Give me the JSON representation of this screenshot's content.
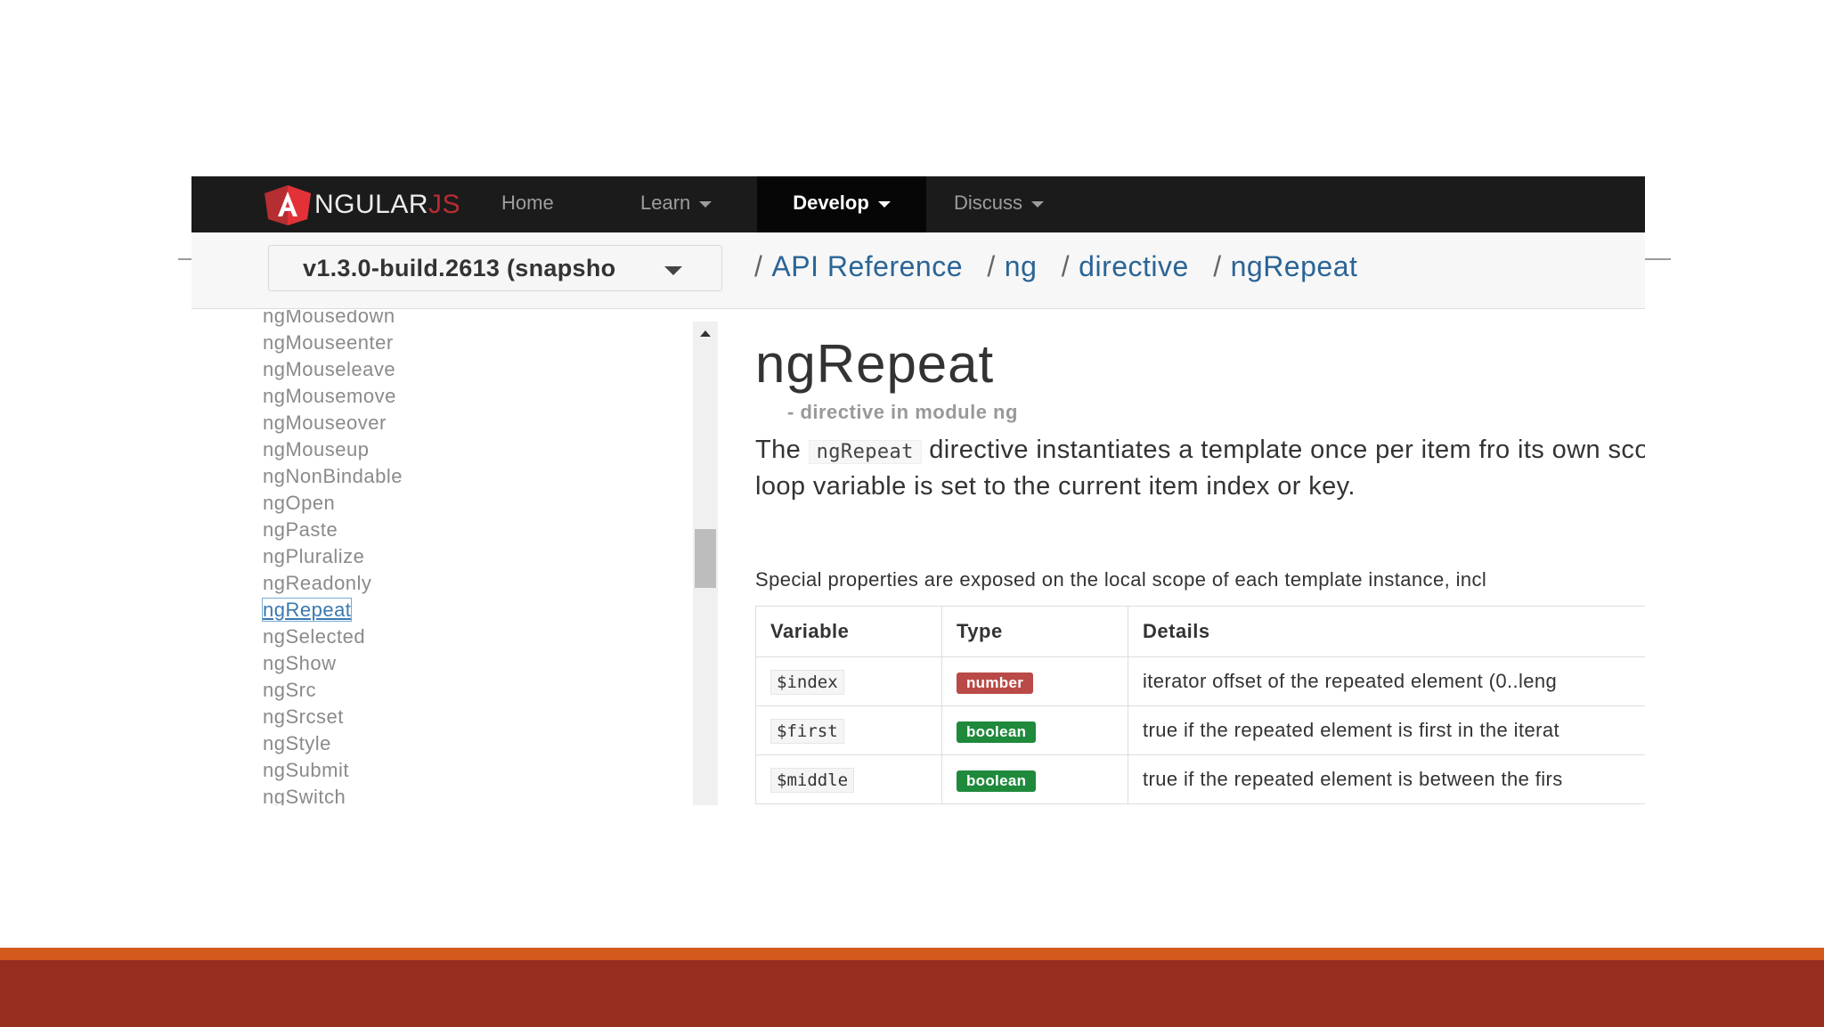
{
  "navbar": {
    "brand": {
      "main": "NGULAR",
      "suffix": "JS",
      "logo_letter": "A"
    },
    "items": [
      {
        "label": "Home",
        "has_caret": false,
        "active": false
      },
      {
        "label": "Learn",
        "has_caret": true,
        "active": false
      },
      {
        "label": "Develop",
        "has_caret": true,
        "active": true
      },
      {
        "label": "Discuss",
        "has_caret": true,
        "active": false
      }
    ]
  },
  "version_select": {
    "value": "v1.3.0-build.2613 (snapsho"
  },
  "breadcrumb": {
    "items": [
      "API Reference",
      "ng",
      "directive"
    ],
    "current": "ngRepeat"
  },
  "sidebar": {
    "items": [
      "ngMousedown",
      "ngMouseenter",
      "ngMouseleave",
      "ngMousemove",
      "ngMouseover",
      "ngMouseup",
      "ngNonBindable",
      "ngOpen",
      "ngPaste",
      "ngPluralize",
      "ngReadonly",
      "ngRepeat",
      "ngSelected",
      "ngShow",
      "ngSrc",
      "ngSrcset",
      "ngStyle",
      "ngSubmit",
      "ngSwitch"
    ],
    "active": "ngRepeat"
  },
  "content": {
    "title": "ngRepeat",
    "subtitle": "- directive in module ng",
    "intro_before": "The",
    "intro_code": "ngRepeat",
    "intro_after": "directive instantiates a template once per item fro its own scope, where the given loop variable is set to the current item index or key.",
    "note": "Special properties are exposed on the local scope of each template instance, incl",
    "table": {
      "headers": [
        "Variable",
        "Type",
        "Details"
      ],
      "rows": [
        {
          "variable": "$index",
          "type": "number",
          "details": "iterator offset of the repeated element (0..leng"
        },
        {
          "variable": "$first",
          "type": "boolean",
          "details": "true if the repeated element is first in the iterat"
        },
        {
          "variable": "$middle",
          "type": "boolean",
          "details": "true if the repeated element is between the firs"
        }
      ]
    }
  },
  "colors": {
    "navbar_bg": "#1b1b1b",
    "link": "#2a6496",
    "badge_number": "#b94a48",
    "badge_boolean": "#1f8a3c",
    "slide_band": "#972d1f",
    "slide_band_accent": "#d35a1c"
  }
}
